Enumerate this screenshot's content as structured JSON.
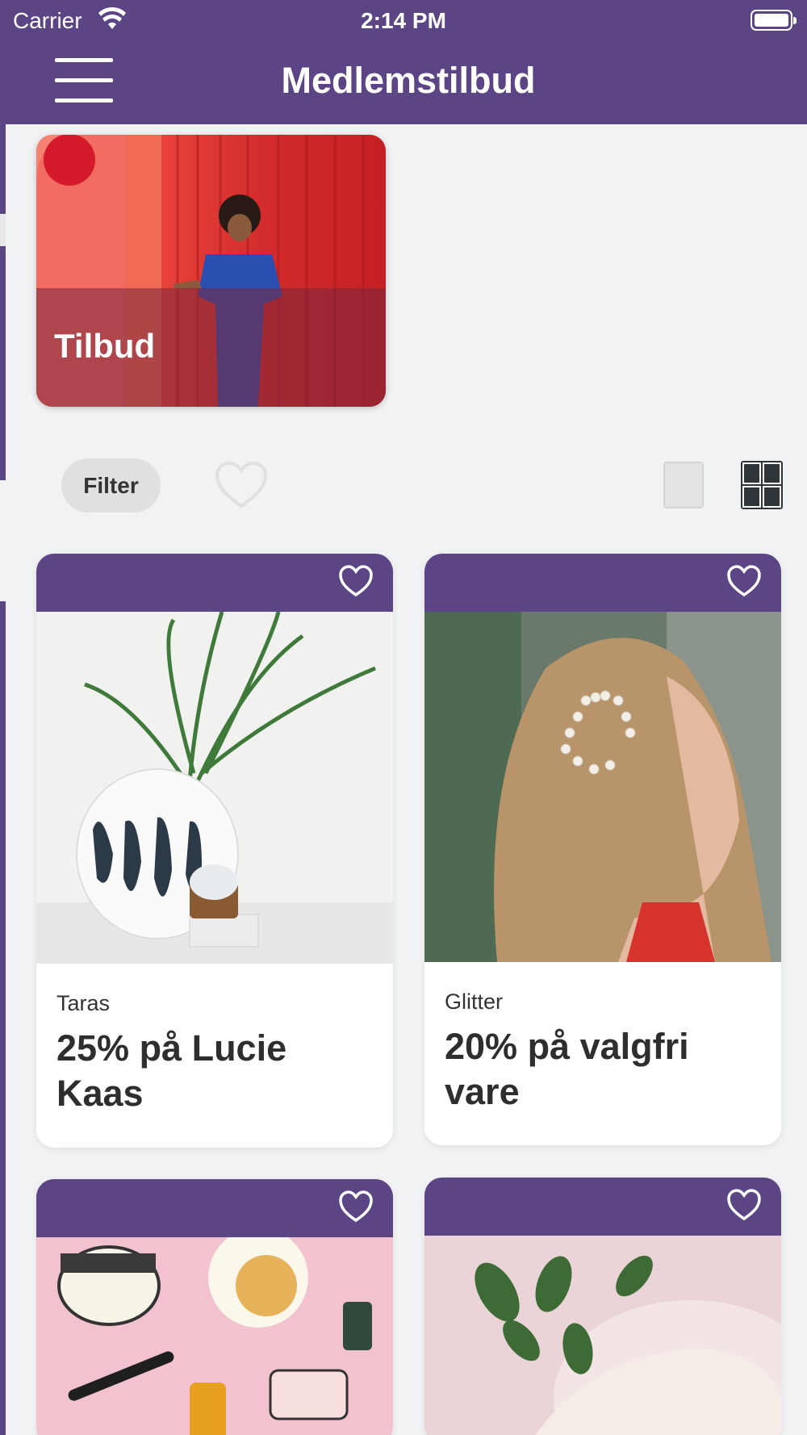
{
  "status_bar": {
    "carrier": "Carrier",
    "time": "2:14 PM"
  },
  "header": {
    "title": "Medlemstilbud"
  },
  "hero": {
    "title": "Tilbud"
  },
  "toolbar": {
    "filter_label": "Filter"
  },
  "colors": {
    "brand": "#5b4585",
    "background": "#f0f2f3"
  },
  "offers": [
    {
      "brand": "Taras",
      "offer": "25% på Lucie Kaas"
    },
    {
      "brand": "Glitter",
      "offer": "20% på valgfri vare"
    },
    {
      "brand": "",
      "offer": ""
    },
    {
      "brand": "",
      "offer": ""
    }
  ]
}
